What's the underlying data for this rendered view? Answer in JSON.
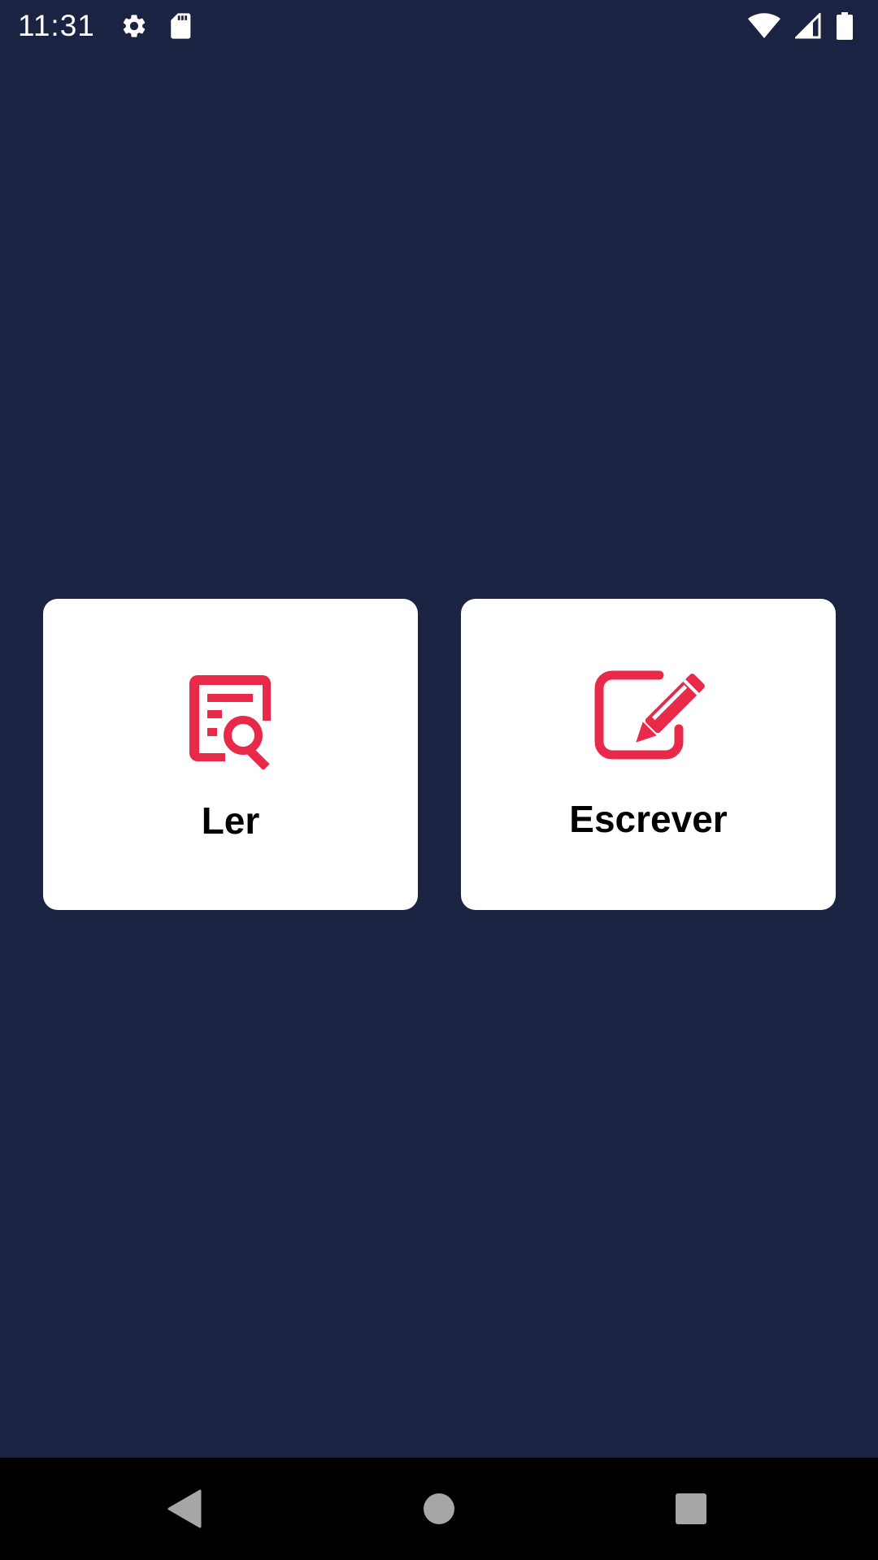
{
  "status_bar": {
    "time": "11:31",
    "left_icons": [
      "gear-icon",
      "sd-card-icon"
    ],
    "right_icons": [
      "wifi-icon",
      "signal-icon",
      "battery-icon"
    ]
  },
  "actions": {
    "read": {
      "label": "Ler",
      "icon": "document-search-icon"
    },
    "write": {
      "label": "Escrever",
      "icon": "edit-pencil-icon"
    }
  },
  "nav_bar": {
    "buttons": [
      "back-icon",
      "home-icon",
      "recents-icon"
    ]
  },
  "colors": {
    "background": "#1b2342",
    "card": "#ffffff",
    "accent": "#e8294a",
    "text": "#000000",
    "nav_bar": "#000000",
    "nav_icons": "#a6a6a6"
  }
}
